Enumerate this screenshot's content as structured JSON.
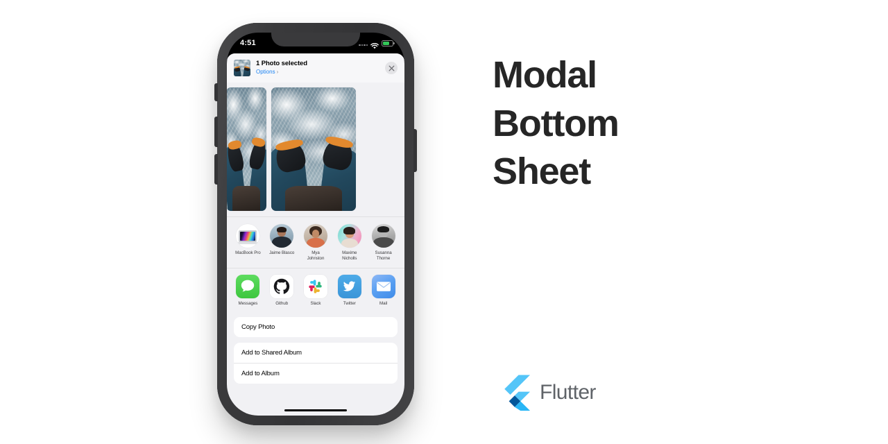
{
  "headline": {
    "line1": "Modal",
    "line2": "Bottom",
    "line3": "Sheet"
  },
  "brand": {
    "name": "Flutter",
    "logo_colors": {
      "light_blue": "#54C5F8",
      "mid_blue": "#42A5F5",
      "dark_blue": "#01579B"
    }
  },
  "phone": {
    "status_bar": {
      "time": "4:51",
      "wifi_icon": "wifi-icon",
      "battery_icon": "battery-icon",
      "signal_icon": "signal-dots-icon",
      "battery_color": "#34C759"
    },
    "home_indicator": "home-indicator"
  },
  "share_sheet": {
    "header": {
      "title": "1 Photo selected",
      "options_label": "Options",
      "options_chevron": "chevron-right-icon",
      "options_color": "#1C83F2",
      "close_icon": "close-icon",
      "thumbnail": "selected-photo-thumbnail"
    },
    "photos": [
      {
        "alt": "ocean-feet-photo-1"
      },
      {
        "alt": "ocean-feet-photo-2"
      },
      {
        "alt": "ocean-feet-photo-3"
      }
    ],
    "contacts": [
      {
        "label": "MacBook Pro",
        "avatar": "macbook-pro-device-icon"
      },
      {
        "label": "Jaime Blasco",
        "avatar": "contact-avatar-jaime"
      },
      {
        "label": "Mya\nJohnston",
        "label_l1": "Mya",
        "label_l2": "Johnston",
        "avatar": "contact-avatar-mya"
      },
      {
        "label": "Maxime\nNicholls",
        "label_l1": "Maxime",
        "label_l2": "Nicholls",
        "avatar": "contact-avatar-maxime"
      },
      {
        "label": "Susanna\nThorne",
        "label_l1": "Susanna",
        "label_l2": "Thorne",
        "avatar": "contact-avatar-susanna"
      }
    ],
    "apps": [
      {
        "label": "Messages",
        "icon": "messages-app-icon",
        "color": "#3EC63F"
      },
      {
        "label": "Github",
        "icon": "github-app-icon",
        "color": "#000000"
      },
      {
        "label": "Slack",
        "icon": "slack-app-icon",
        "color": "#FFFFFF"
      },
      {
        "label": "Twitter",
        "icon": "twitter-app-icon",
        "color": "#3A95D8"
      },
      {
        "label": "Mail",
        "icon": "mail-app-icon",
        "color": "#5AA0F2"
      }
    ],
    "action_groups": [
      {
        "items": [
          {
            "label": "Copy Photo"
          }
        ]
      },
      {
        "items": [
          {
            "label": "Add to Shared Album"
          },
          {
            "label": "Add to Album"
          }
        ]
      }
    ]
  }
}
